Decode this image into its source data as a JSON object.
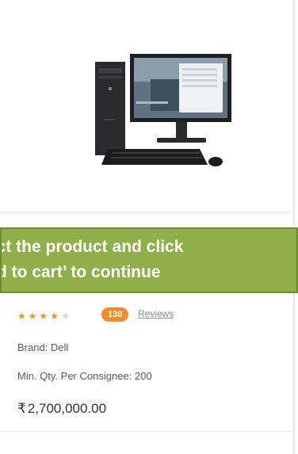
{
  "banner": {
    "line1": "ect the product and click",
    "line2": "d to cart’ to continue"
  },
  "product": {
    "rating": 4,
    "rating_max": 5,
    "review_count": "130",
    "reviews_link": "Reviews",
    "brand": "Brand: Dell",
    "min_qty": "Min. Qty. Per Consignee: 200",
    "currency_symbol": "₹",
    "price": "2,700,000.00",
    "image_icon": "desktop-computer-icon"
  },
  "colors": {
    "banner_bg": "#8faf4a",
    "star": "#f0931c",
    "badge": "#f28c28"
  }
}
